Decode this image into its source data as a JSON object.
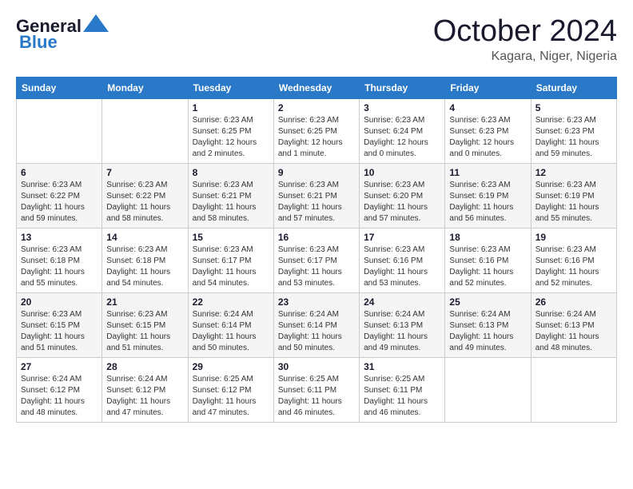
{
  "header": {
    "logo_line1": "General",
    "logo_line2": "Blue",
    "month": "October 2024",
    "location": "Kagara, Niger, Nigeria"
  },
  "weekdays": [
    "Sunday",
    "Monday",
    "Tuesday",
    "Wednesday",
    "Thursday",
    "Friday",
    "Saturday"
  ],
  "weeks": [
    [
      {
        "day": "",
        "info": ""
      },
      {
        "day": "",
        "info": ""
      },
      {
        "day": "1",
        "info": "Sunrise: 6:23 AM\nSunset: 6:25 PM\nDaylight: 12 hours\nand 2 minutes."
      },
      {
        "day": "2",
        "info": "Sunrise: 6:23 AM\nSunset: 6:25 PM\nDaylight: 12 hours\nand 1 minute."
      },
      {
        "day": "3",
        "info": "Sunrise: 6:23 AM\nSunset: 6:24 PM\nDaylight: 12 hours\nand 0 minutes."
      },
      {
        "day": "4",
        "info": "Sunrise: 6:23 AM\nSunset: 6:23 PM\nDaylight: 12 hours\nand 0 minutes."
      },
      {
        "day": "5",
        "info": "Sunrise: 6:23 AM\nSunset: 6:23 PM\nDaylight: 11 hours\nand 59 minutes."
      }
    ],
    [
      {
        "day": "6",
        "info": "Sunrise: 6:23 AM\nSunset: 6:22 PM\nDaylight: 11 hours\nand 59 minutes."
      },
      {
        "day": "7",
        "info": "Sunrise: 6:23 AM\nSunset: 6:22 PM\nDaylight: 11 hours\nand 58 minutes."
      },
      {
        "day": "8",
        "info": "Sunrise: 6:23 AM\nSunset: 6:21 PM\nDaylight: 11 hours\nand 58 minutes."
      },
      {
        "day": "9",
        "info": "Sunrise: 6:23 AM\nSunset: 6:21 PM\nDaylight: 11 hours\nand 57 minutes."
      },
      {
        "day": "10",
        "info": "Sunrise: 6:23 AM\nSunset: 6:20 PM\nDaylight: 11 hours\nand 57 minutes."
      },
      {
        "day": "11",
        "info": "Sunrise: 6:23 AM\nSunset: 6:19 PM\nDaylight: 11 hours\nand 56 minutes."
      },
      {
        "day": "12",
        "info": "Sunrise: 6:23 AM\nSunset: 6:19 PM\nDaylight: 11 hours\nand 55 minutes."
      }
    ],
    [
      {
        "day": "13",
        "info": "Sunrise: 6:23 AM\nSunset: 6:18 PM\nDaylight: 11 hours\nand 55 minutes."
      },
      {
        "day": "14",
        "info": "Sunrise: 6:23 AM\nSunset: 6:18 PM\nDaylight: 11 hours\nand 54 minutes."
      },
      {
        "day": "15",
        "info": "Sunrise: 6:23 AM\nSunset: 6:17 PM\nDaylight: 11 hours\nand 54 minutes."
      },
      {
        "day": "16",
        "info": "Sunrise: 6:23 AM\nSunset: 6:17 PM\nDaylight: 11 hours\nand 53 minutes."
      },
      {
        "day": "17",
        "info": "Sunrise: 6:23 AM\nSunset: 6:16 PM\nDaylight: 11 hours\nand 53 minutes."
      },
      {
        "day": "18",
        "info": "Sunrise: 6:23 AM\nSunset: 6:16 PM\nDaylight: 11 hours\nand 52 minutes."
      },
      {
        "day": "19",
        "info": "Sunrise: 6:23 AM\nSunset: 6:16 PM\nDaylight: 11 hours\nand 52 minutes."
      }
    ],
    [
      {
        "day": "20",
        "info": "Sunrise: 6:23 AM\nSunset: 6:15 PM\nDaylight: 11 hours\nand 51 minutes."
      },
      {
        "day": "21",
        "info": "Sunrise: 6:23 AM\nSunset: 6:15 PM\nDaylight: 11 hours\nand 51 minutes."
      },
      {
        "day": "22",
        "info": "Sunrise: 6:24 AM\nSunset: 6:14 PM\nDaylight: 11 hours\nand 50 minutes."
      },
      {
        "day": "23",
        "info": "Sunrise: 6:24 AM\nSunset: 6:14 PM\nDaylight: 11 hours\nand 50 minutes."
      },
      {
        "day": "24",
        "info": "Sunrise: 6:24 AM\nSunset: 6:13 PM\nDaylight: 11 hours\nand 49 minutes."
      },
      {
        "day": "25",
        "info": "Sunrise: 6:24 AM\nSunset: 6:13 PM\nDaylight: 11 hours\nand 49 minutes."
      },
      {
        "day": "26",
        "info": "Sunrise: 6:24 AM\nSunset: 6:13 PM\nDaylight: 11 hours\nand 48 minutes."
      }
    ],
    [
      {
        "day": "27",
        "info": "Sunrise: 6:24 AM\nSunset: 6:12 PM\nDaylight: 11 hours\nand 48 minutes."
      },
      {
        "day": "28",
        "info": "Sunrise: 6:24 AM\nSunset: 6:12 PM\nDaylight: 11 hours\nand 47 minutes."
      },
      {
        "day": "29",
        "info": "Sunrise: 6:25 AM\nSunset: 6:12 PM\nDaylight: 11 hours\nand 47 minutes."
      },
      {
        "day": "30",
        "info": "Sunrise: 6:25 AM\nSunset: 6:11 PM\nDaylight: 11 hours\nand 46 minutes."
      },
      {
        "day": "31",
        "info": "Sunrise: 6:25 AM\nSunset: 6:11 PM\nDaylight: 11 hours\nand 46 minutes."
      },
      {
        "day": "",
        "info": ""
      },
      {
        "day": "",
        "info": ""
      }
    ]
  ]
}
